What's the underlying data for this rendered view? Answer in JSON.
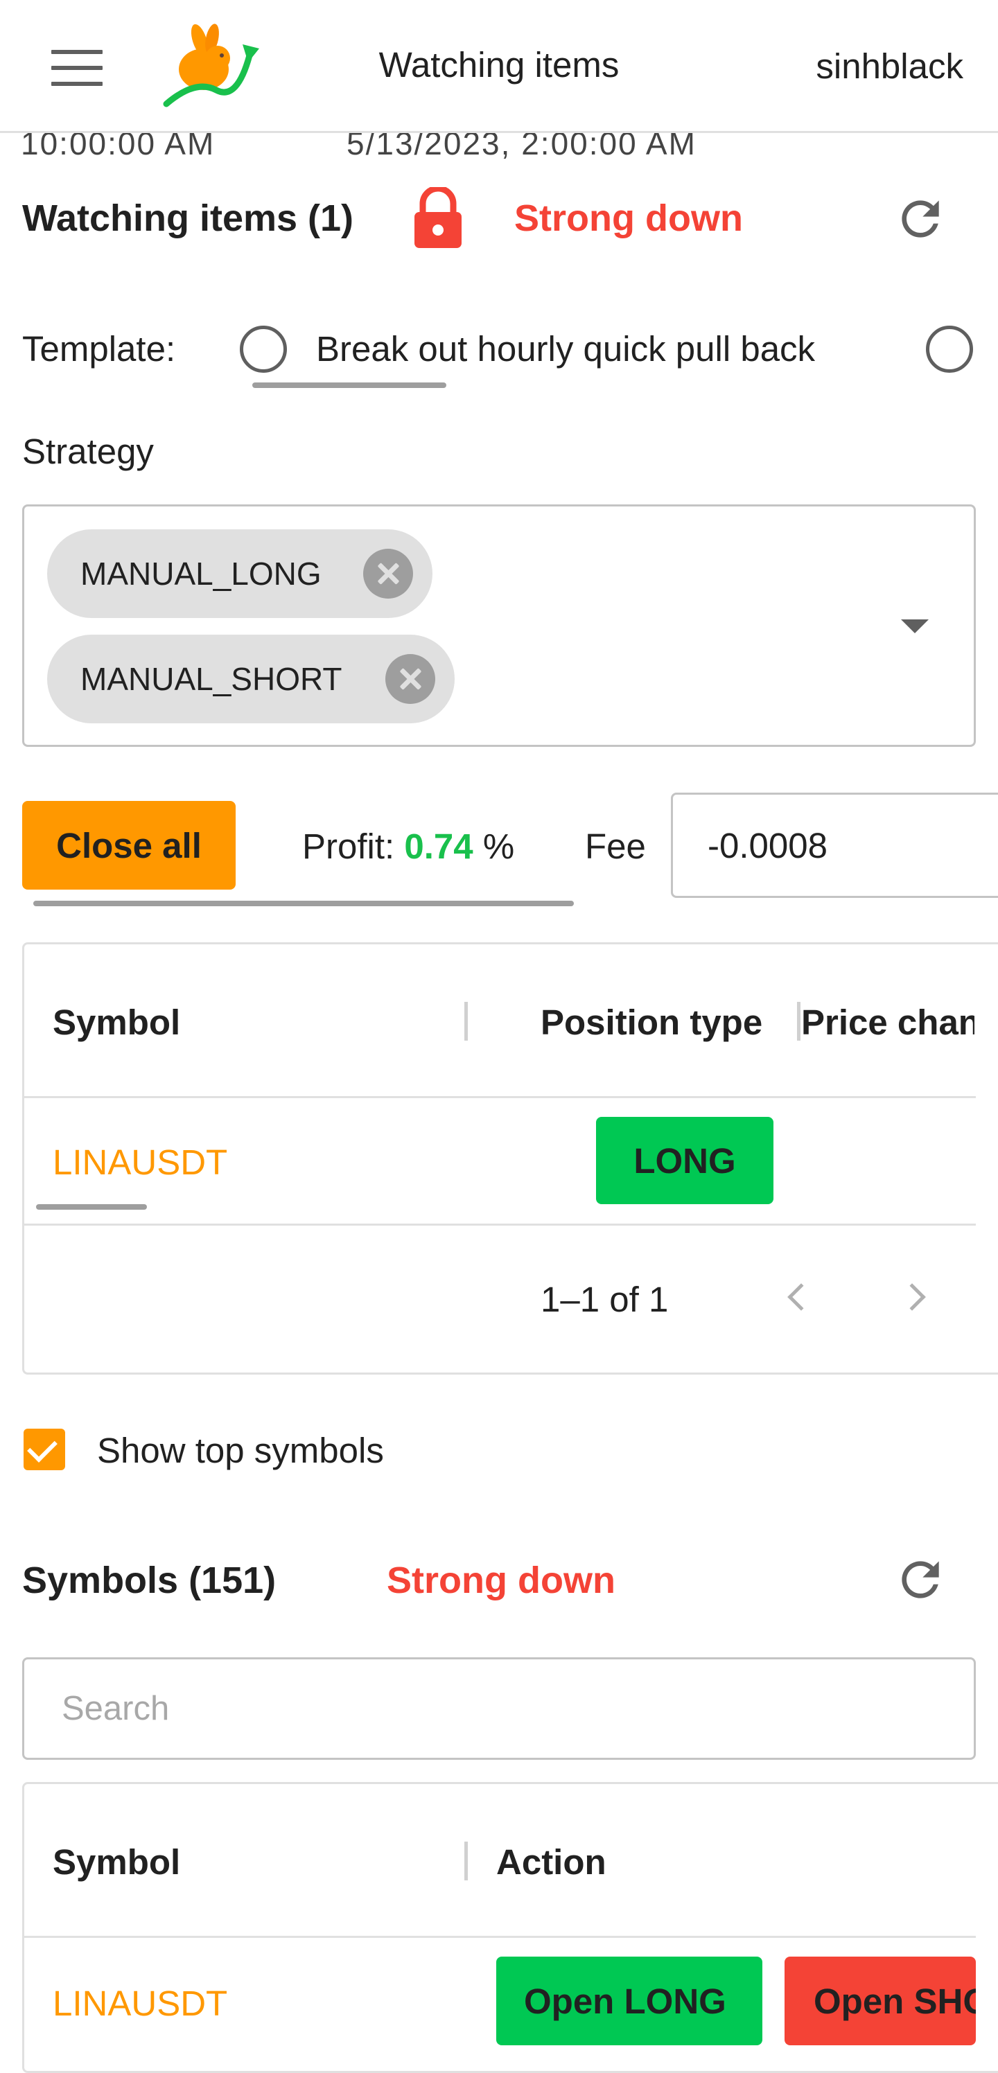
{
  "header": {
    "title": "Watching items",
    "username": "sinhblack",
    "scrolled_text_left": "10:00:00 AM",
    "scrolled_text_right": "5/13/2023, 2:00:00 AM"
  },
  "watching": {
    "title": "Watching items (1)",
    "lock_icon": "lock-icon",
    "trend": "Strong down",
    "template_label": "Template:",
    "template_option": "Break out hourly quick pull back",
    "strategy_label": "Strategy",
    "strategies": [
      "MANUAL_LONG",
      "MANUAL_SHORT"
    ],
    "close_all_label": "Close all",
    "profit_label": "Profit:",
    "profit_value": "0.74",
    "profit_unit": "%",
    "fee_label": "Fee",
    "fee_value": "-0.0008",
    "table": {
      "headers": [
        "Symbol",
        "Position type",
        "Price change"
      ],
      "rows": [
        {
          "symbol": "LINAUSDT",
          "position": "LONG"
        }
      ],
      "pagination": "1–1 of 1"
    }
  },
  "show_top_symbols": {
    "label": "Show top symbols",
    "checked": true
  },
  "symbols": {
    "title": "Symbols (151)",
    "trend": "Strong down",
    "search_placeholder": "Search",
    "table": {
      "headers": [
        "Symbol",
        "Action"
      ],
      "rows": [
        {
          "symbol": "LINAUSDT",
          "open_long": "Open LONG",
          "open_short": "Open SHORT"
        }
      ]
    }
  },
  "colors": {
    "accent": "#ff9800",
    "trend_red": "#f44336",
    "profit_green": "#19c04c",
    "long_green": "#00c853"
  }
}
